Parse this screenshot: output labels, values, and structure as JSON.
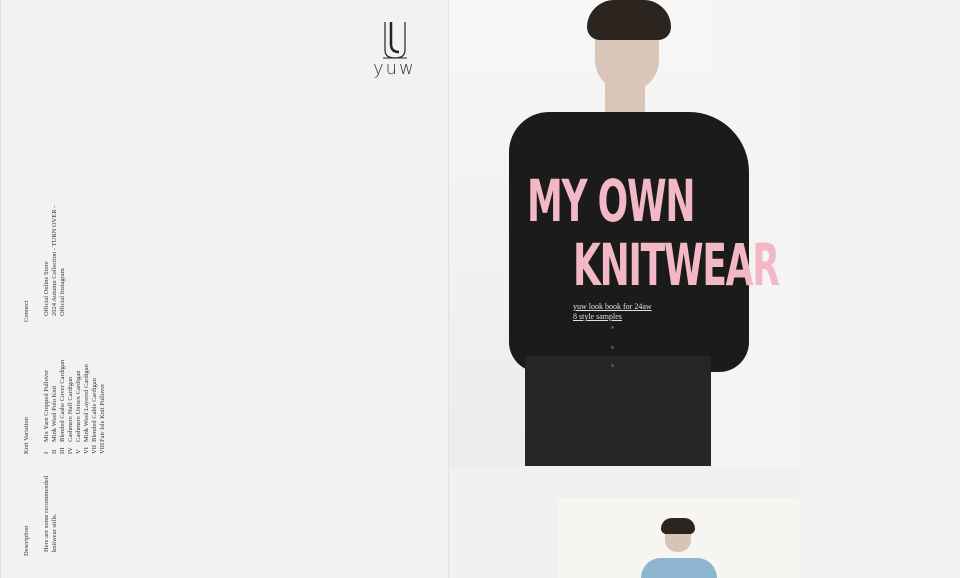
{
  "brand": {
    "logo_text": "yuw",
    "logo_mark": "u-lettermark-icon"
  },
  "sidebar": {
    "connect": {
      "heading": "Connect",
      "links": [
        "Official Online Store",
        "2024 Autumn Collection - TURN OVER -",
        "Official Instagram"
      ]
    },
    "knit_variation": {
      "heading": "Knit Variation",
      "items": [
        {
          "num": "I",
          "label": "Mix Yarn Cropped Pullover"
        },
        {
          "num": "II",
          "label": "Mink Wool Polo Knit"
        },
        {
          "num": "III",
          "label": "Blended Cashe Cover Cardigan"
        },
        {
          "num": "IV",
          "label": "Cashmere Nuff Cardigan"
        },
        {
          "num": "V",
          "label": "Cashmere Unisex Cardigan"
        },
        {
          "num": "VI",
          "label": "Mink Wool Layered Cardigan"
        },
        {
          "num": "VII",
          "label": "Blended Cable Cardigan"
        },
        {
          "num": "VIII",
          "label": "Fair Isle Knit Pullover"
        }
      ]
    },
    "description": {
      "heading": "Description",
      "lines": [
        "Here are some recommended",
        "knitwear stills."
      ]
    }
  },
  "hero": {
    "headline_line1": "MY OWN",
    "headline_line2": "KNITWEAR",
    "link1": "yuw look book for 24aw",
    "link2": "8 style samples",
    "headline_color": "#f2b8c6"
  }
}
